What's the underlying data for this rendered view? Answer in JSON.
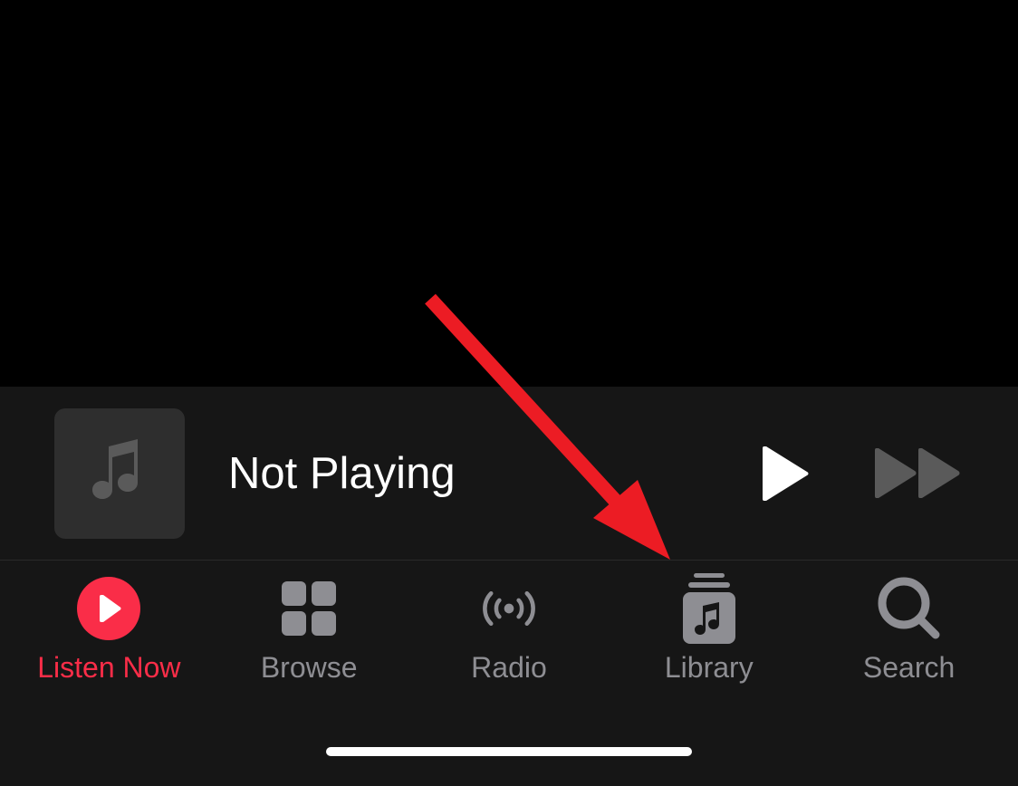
{
  "now_playing": {
    "status_text": "Not Playing"
  },
  "tabs": {
    "listen_now": "Listen Now",
    "browse": "Browse",
    "radio": "Radio",
    "library": "Library",
    "search": "Search"
  },
  "colors": {
    "accent": "#fa2d48",
    "inactive": "#8e8e93",
    "annotation": "#ec1c24"
  }
}
